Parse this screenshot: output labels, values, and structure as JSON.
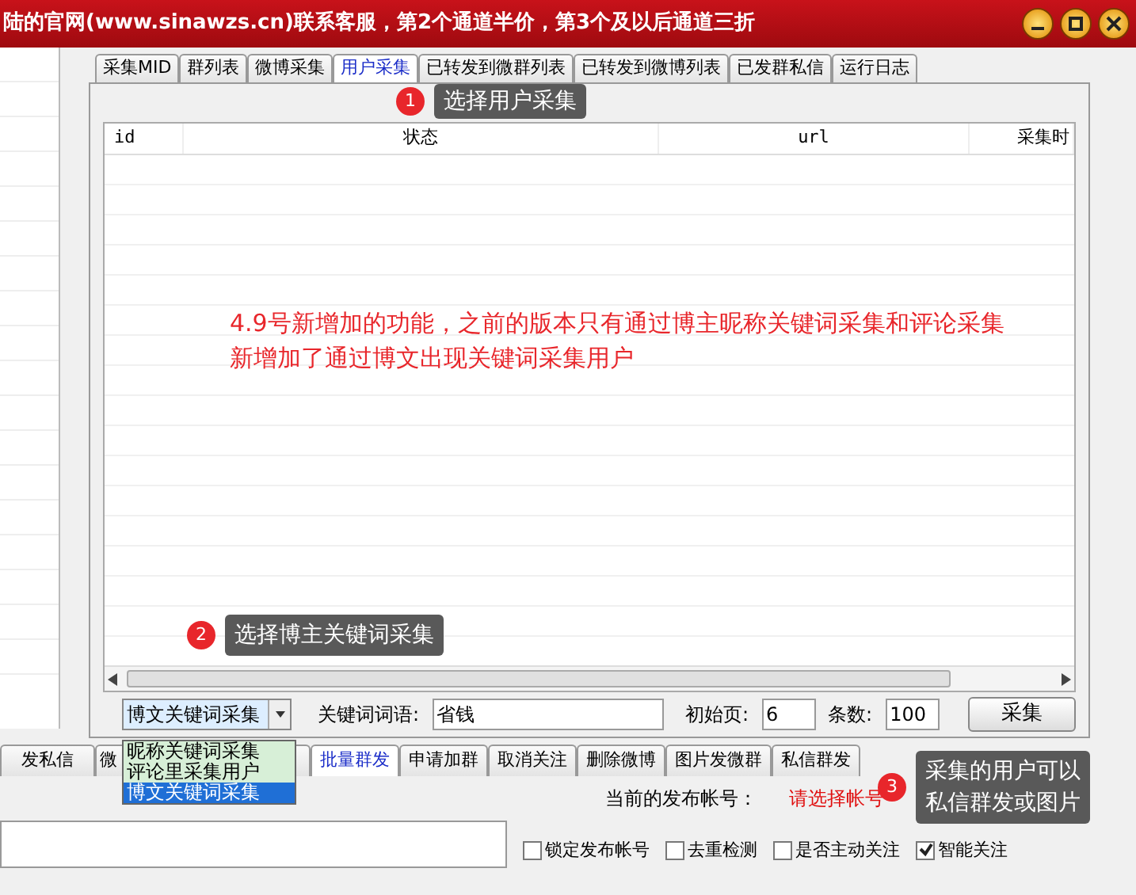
{
  "window": {
    "title": "陆的官网(www.sinawzs.cn)联系客服，第2个通道半价，第3个及以后通道三折"
  },
  "top_tabs": [
    {
      "label": "采集MID",
      "selected": false
    },
    {
      "label": "群列表",
      "selected": false
    },
    {
      "label": "微博采集",
      "selected": false
    },
    {
      "label": "用户采集",
      "selected": true
    },
    {
      "label": "已转发到微群列表",
      "selected": false
    },
    {
      "label": "已转发到微博列表",
      "selected": false
    },
    {
      "label": "已发群私信",
      "selected": false
    },
    {
      "label": "运行日志",
      "selected": false
    }
  ],
  "table": {
    "columns": [
      "id",
      "状态",
      "url",
      "采集时"
    ]
  },
  "note": [
    "4.9号新增加的功能，之前的版本只有通过博主昵称关键词采集和评论采集",
    "新增加了通过博文出现关键词采集用户"
  ],
  "controls": {
    "mode": {
      "value": "博文关键词采集",
      "options": [
        {
          "label": "昵称关键词采集",
          "selected": false
        },
        {
          "label": "评论里采集用户",
          "selected": false
        },
        {
          "label": "博文关键词采集",
          "selected": true
        }
      ]
    },
    "keyword": {
      "label": "关键词词语:",
      "value": "省钱"
    },
    "start_page": {
      "label": "初始页:",
      "value": "6"
    },
    "count": {
      "label": "条数:",
      "value": "100"
    },
    "button": "采集"
  },
  "bottom_tabs": [
    {
      "label": "发私信",
      "selected": false
    },
    {
      "label": "微",
      "selected": false
    },
    {
      "label": "批量群发",
      "selected": true
    },
    {
      "label": "申请加群",
      "selected": false
    },
    {
      "label": "取消关注",
      "selected": false
    },
    {
      "label": "删除微博",
      "selected": false
    },
    {
      "label": "图片发微群",
      "selected": false
    },
    {
      "label": "私信群发",
      "selected": false
    }
  ],
  "account": {
    "label": "当前的发布帐号：",
    "value": "请选择帐号"
  },
  "options": [
    {
      "label": "锁定发布帐号",
      "checked": false
    },
    {
      "label": "去重检测",
      "checked": false
    },
    {
      "label": "是否主动关注",
      "checked": false
    },
    {
      "label": "智能关注",
      "checked": true
    }
  ],
  "callouts": [
    {
      "number": "1",
      "text": [
        "选择用户采集"
      ]
    },
    {
      "number": "2",
      "text": [
        "选择博主关键词采集"
      ]
    },
    {
      "number": "3",
      "text": [
        "采集的用户可以",
        "私信群发或图片"
      ]
    }
  ]
}
